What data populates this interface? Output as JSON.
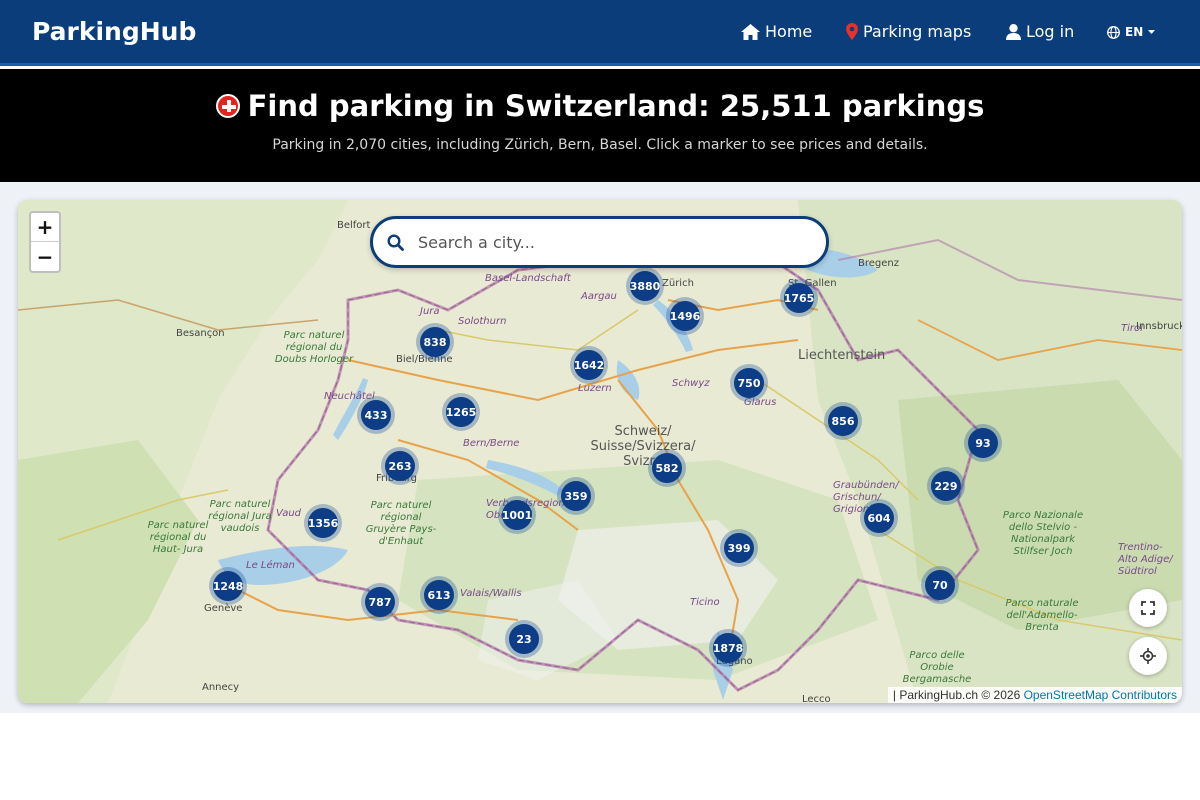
{
  "navbar": {
    "brand": "ParkingHub",
    "items": [
      {
        "label": "Home",
        "icon": "home-icon"
      },
      {
        "label": "Parking maps",
        "icon": "map-pin-icon"
      },
      {
        "label": "Log in",
        "icon": "user-icon"
      }
    ],
    "language": "EN"
  },
  "hero": {
    "title": "Find parking in Switzerland: 25,511 parkings",
    "subtitle": "Parking in 2,070 cities, including Zürich, Bern, Basel. Click a marker to see prices and details."
  },
  "map": {
    "zoom_in": "+",
    "zoom_out": "−",
    "search_placeholder": "Search a city...",
    "clusters": [
      "3880",
      "1496",
      "1765",
      "838",
      "1642",
      "750",
      "433",
      "1265",
      "856",
      "93",
      "263",
      "582",
      "229",
      "359",
      "1001",
      "1356",
      "604",
      "399",
      "1248",
      "70",
      "787",
      "613",
      "23",
      "1878"
    ],
    "labels": {
      "belfort": "Belfort",
      "besancon": "Besançon",
      "bregenz": "Bregenz",
      "st_gallen": "St. Gallen",
      "liechtenstein": "Liechtenstein",
      "zurich": "Zürich",
      "aargau": "Aargau",
      "basel_landschaft": "Basel-Landschaft",
      "jura": "Jura",
      "solothurn": "Solothurn",
      "biel": "Biel/Bienne",
      "luzern": "Luzern",
      "schwyz": "Schwyz",
      "glarus": "Glarus",
      "neuchatel": "Neuchâtel",
      "bern": "Bern/Berne",
      "schweiz": "Schweiz/ Suisse/Svizzera/ Svizra",
      "fribourg": "Fribourg",
      "graubunden": "Graubünden/ Grischun/ Grigioni",
      "vaud": "Vaud",
      "le_leman": "Le Léman",
      "geneve": "Genève",
      "valais": "Valais/Wallis",
      "ticino": "Ticino",
      "lugano": "Lugano",
      "annecy": "Annecy",
      "lecco": "Lecco",
      "tirol": "Tirol",
      "innsbruck": "Innsbruck",
      "trentino": "Trentino- Alto Adige/ Südtirol",
      "park_doubs": "Parc naturel régional du Doubs Horloger",
      "park_jura_vaudois": "Parc naturel régional Jura vaudois",
      "park_haut_jura": "Parc naturel régional du Haut- Jura",
      "park_gruyere": "Parc naturel régional Gruyère Pays-d'Enhaut",
      "park_stelvio": "Parco Nazionale dello Stelvio - Nationalpark Stilfser Joch",
      "park_adamello": "Parco naturale dell'Adamello- Brenta",
      "park_orobie": "Parco delle Orobie Bergamasche",
      "verbier": "Verbandsregion Oberland"
    },
    "attribution_prefix": "| ParkingHub.ch © 2026 ",
    "attribution_link": "OpenStreetMap Contributors"
  }
}
